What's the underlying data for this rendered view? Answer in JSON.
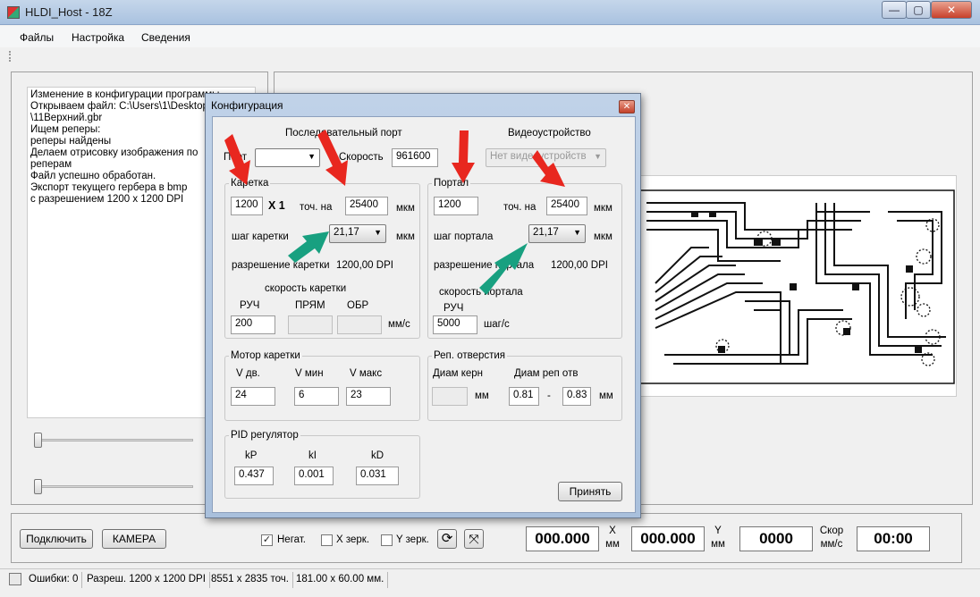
{
  "window": {
    "title": "HLDI_Host - 18Z",
    "controls": {
      "minimize": "—",
      "maximize": "▢",
      "close": "✕"
    }
  },
  "menu": [
    "Файлы",
    "Настройка",
    "Сведения"
  ],
  "log": {
    "lines": [
      "Изменение в конфигурации программы",
      "Открываем файл: C:\\Users\\1\\Desktop",
      "\\11Верхний.gbr",
      "Ищем реперы:",
      "реперы найдены",
      "Делаем отрисовку изображения по",
      "реперам",
      "Файл успешно обработан.",
      "Экспорт текущего гербера в bmp",
      "с разрешением 1200 x 1200 DPI"
    ]
  },
  "dialog": {
    "title": "Конфигурация",
    "close": "✕",
    "serial_header": "Последовательный порт",
    "video_header": "Видеоустройство",
    "port_label": "Порт",
    "port_value": "",
    "speed_label": "Скорость",
    "speed_value": "961600",
    "video_value": "Нет видеоустройств",
    "carriage": {
      "group": "Каретка",
      "dots": "1200",
      "x1": "X 1",
      "per_label": "точ. на",
      "distance": "25400",
      "unit_mkm": "мкм",
      "step_label": "шаг каретки",
      "step_value": "21,17",
      "step_unit": "мкм",
      "res_label": "разрешение каретки",
      "res_value": "1200,00 DPI",
      "speed_header": "скорость каретки",
      "manual": "РУЧ",
      "forward": "ПРЯМ",
      "back": "ОБР",
      "manual_value": "200",
      "forward_value": "",
      "back_value": "",
      "speed_unit": "мм/с"
    },
    "portal": {
      "group": "Портал",
      "dots": "1200",
      "per_label": "точ. на",
      "distance": "25400",
      "unit_mkm": "мкм",
      "step_label": "шаг портала",
      "step_value": "21,17",
      "step_unit": "мкм",
      "res_label": "разрешение портала",
      "res_value": "1200,00 DPI",
      "speed_header": "скорость портала",
      "manual": "РУЧ",
      "manual_value": "5000",
      "speed_unit": "шаг/с"
    },
    "motor": {
      "group": "Мотор каретки",
      "v_dv": "V дв.",
      "v_min": "V мин",
      "v_max": "V макс",
      "v_dv_value": "24",
      "v_min_value": "6",
      "v_max_value": "23"
    },
    "holes": {
      "group": "Реп. отверстия",
      "core_label": "Диам керн",
      "hole_label": "Диам реп отв",
      "core_value": "",
      "mm1": "мм",
      "hole_from": "0.81",
      "dash": "-",
      "hole_to": "0.83",
      "mm2": "мм"
    },
    "pid": {
      "group": "PID регулятор",
      "kp": "kP",
      "ki": "kI",
      "kd": "kD",
      "kp_value": "0.437",
      "ki_value": "0.001",
      "kd_value": "0.031"
    },
    "accept": "Принять"
  },
  "bottom": {
    "connect": "Подключить",
    "camera": "КАМЕРА",
    "neg_label": "Негат.",
    "neg_checked": "✓",
    "xmirror_label": "X зерк.",
    "ymirror_label": "Y зерк.",
    "refresh_icon": "⟳",
    "fit_icon": "⤧",
    "x_value": "000.000",
    "x_label": "X",
    "x_unit": "мм",
    "y_value": "000.000",
    "y_label": "Y",
    "y_unit": "мм",
    "speed_value": "0000",
    "speed_label": "Скор",
    "speed_unit": "мм/с",
    "time_value": "00:00"
  },
  "status": {
    "errors": "Ошибки: 0",
    "resolution": "Разреш. 1200 x 1200 DPI",
    "points": "8551 x 2835 точ.",
    "size": "181.00 x 60.00 мм."
  },
  "colors": {
    "annotation_red": "#e8271f",
    "annotation_green": "#18a080"
  }
}
